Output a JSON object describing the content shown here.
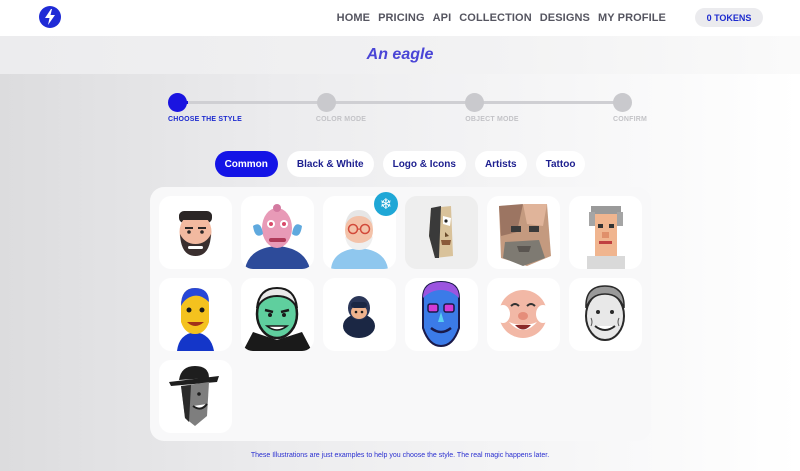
{
  "header": {
    "logo_icon": "lightning-bolt-icon",
    "nav": [
      "HOME",
      "PRICING",
      "API",
      "COLLECTION",
      "DESIGNS",
      "MY PROFILE"
    ],
    "tokens_label": "0 TOKENS"
  },
  "prompt": {
    "text": "An eagle"
  },
  "stepper": {
    "steps": [
      {
        "label": "CHOOSE THE STYLE",
        "active": true
      },
      {
        "label": "COLOR MODE",
        "active": false
      },
      {
        "label": "OBJECT MODE",
        "active": false
      },
      {
        "label": "CONFIRM",
        "active": false
      }
    ]
  },
  "tabs": [
    {
      "label": "Common",
      "active": true
    },
    {
      "label": "Black & White",
      "active": false
    },
    {
      "label": "Logo & Icons",
      "active": false
    },
    {
      "label": "Artists",
      "active": false
    },
    {
      "label": "Tattoo",
      "active": false
    }
  ],
  "styles_grid": {
    "badge_icon": "snowflake-icon",
    "items": [
      "bearded-man-flat-portrait",
      "pink-surreal-face-portrait",
      "old-man-glasses-portrait",
      "cubist-face-portrait",
      "low-poly-old-man-portrait",
      "pixel-art-old-man-portrait",
      "yellow-pop-art-portrait",
      "green-vampire-portrait",
      "hooded-man-portrait",
      "blue-neon-portrait",
      "laughing-old-man-portrait",
      "sketch-old-man-portrait",
      "silhouette-cowboy-portrait"
    ]
  },
  "footnote": "These Illustrations are just examples to help you choose the style. The real magic happens later.",
  "colors": {
    "accent": "#1414e6",
    "brand": "#1f2bd6",
    "prompt": "#4a45d6"
  }
}
